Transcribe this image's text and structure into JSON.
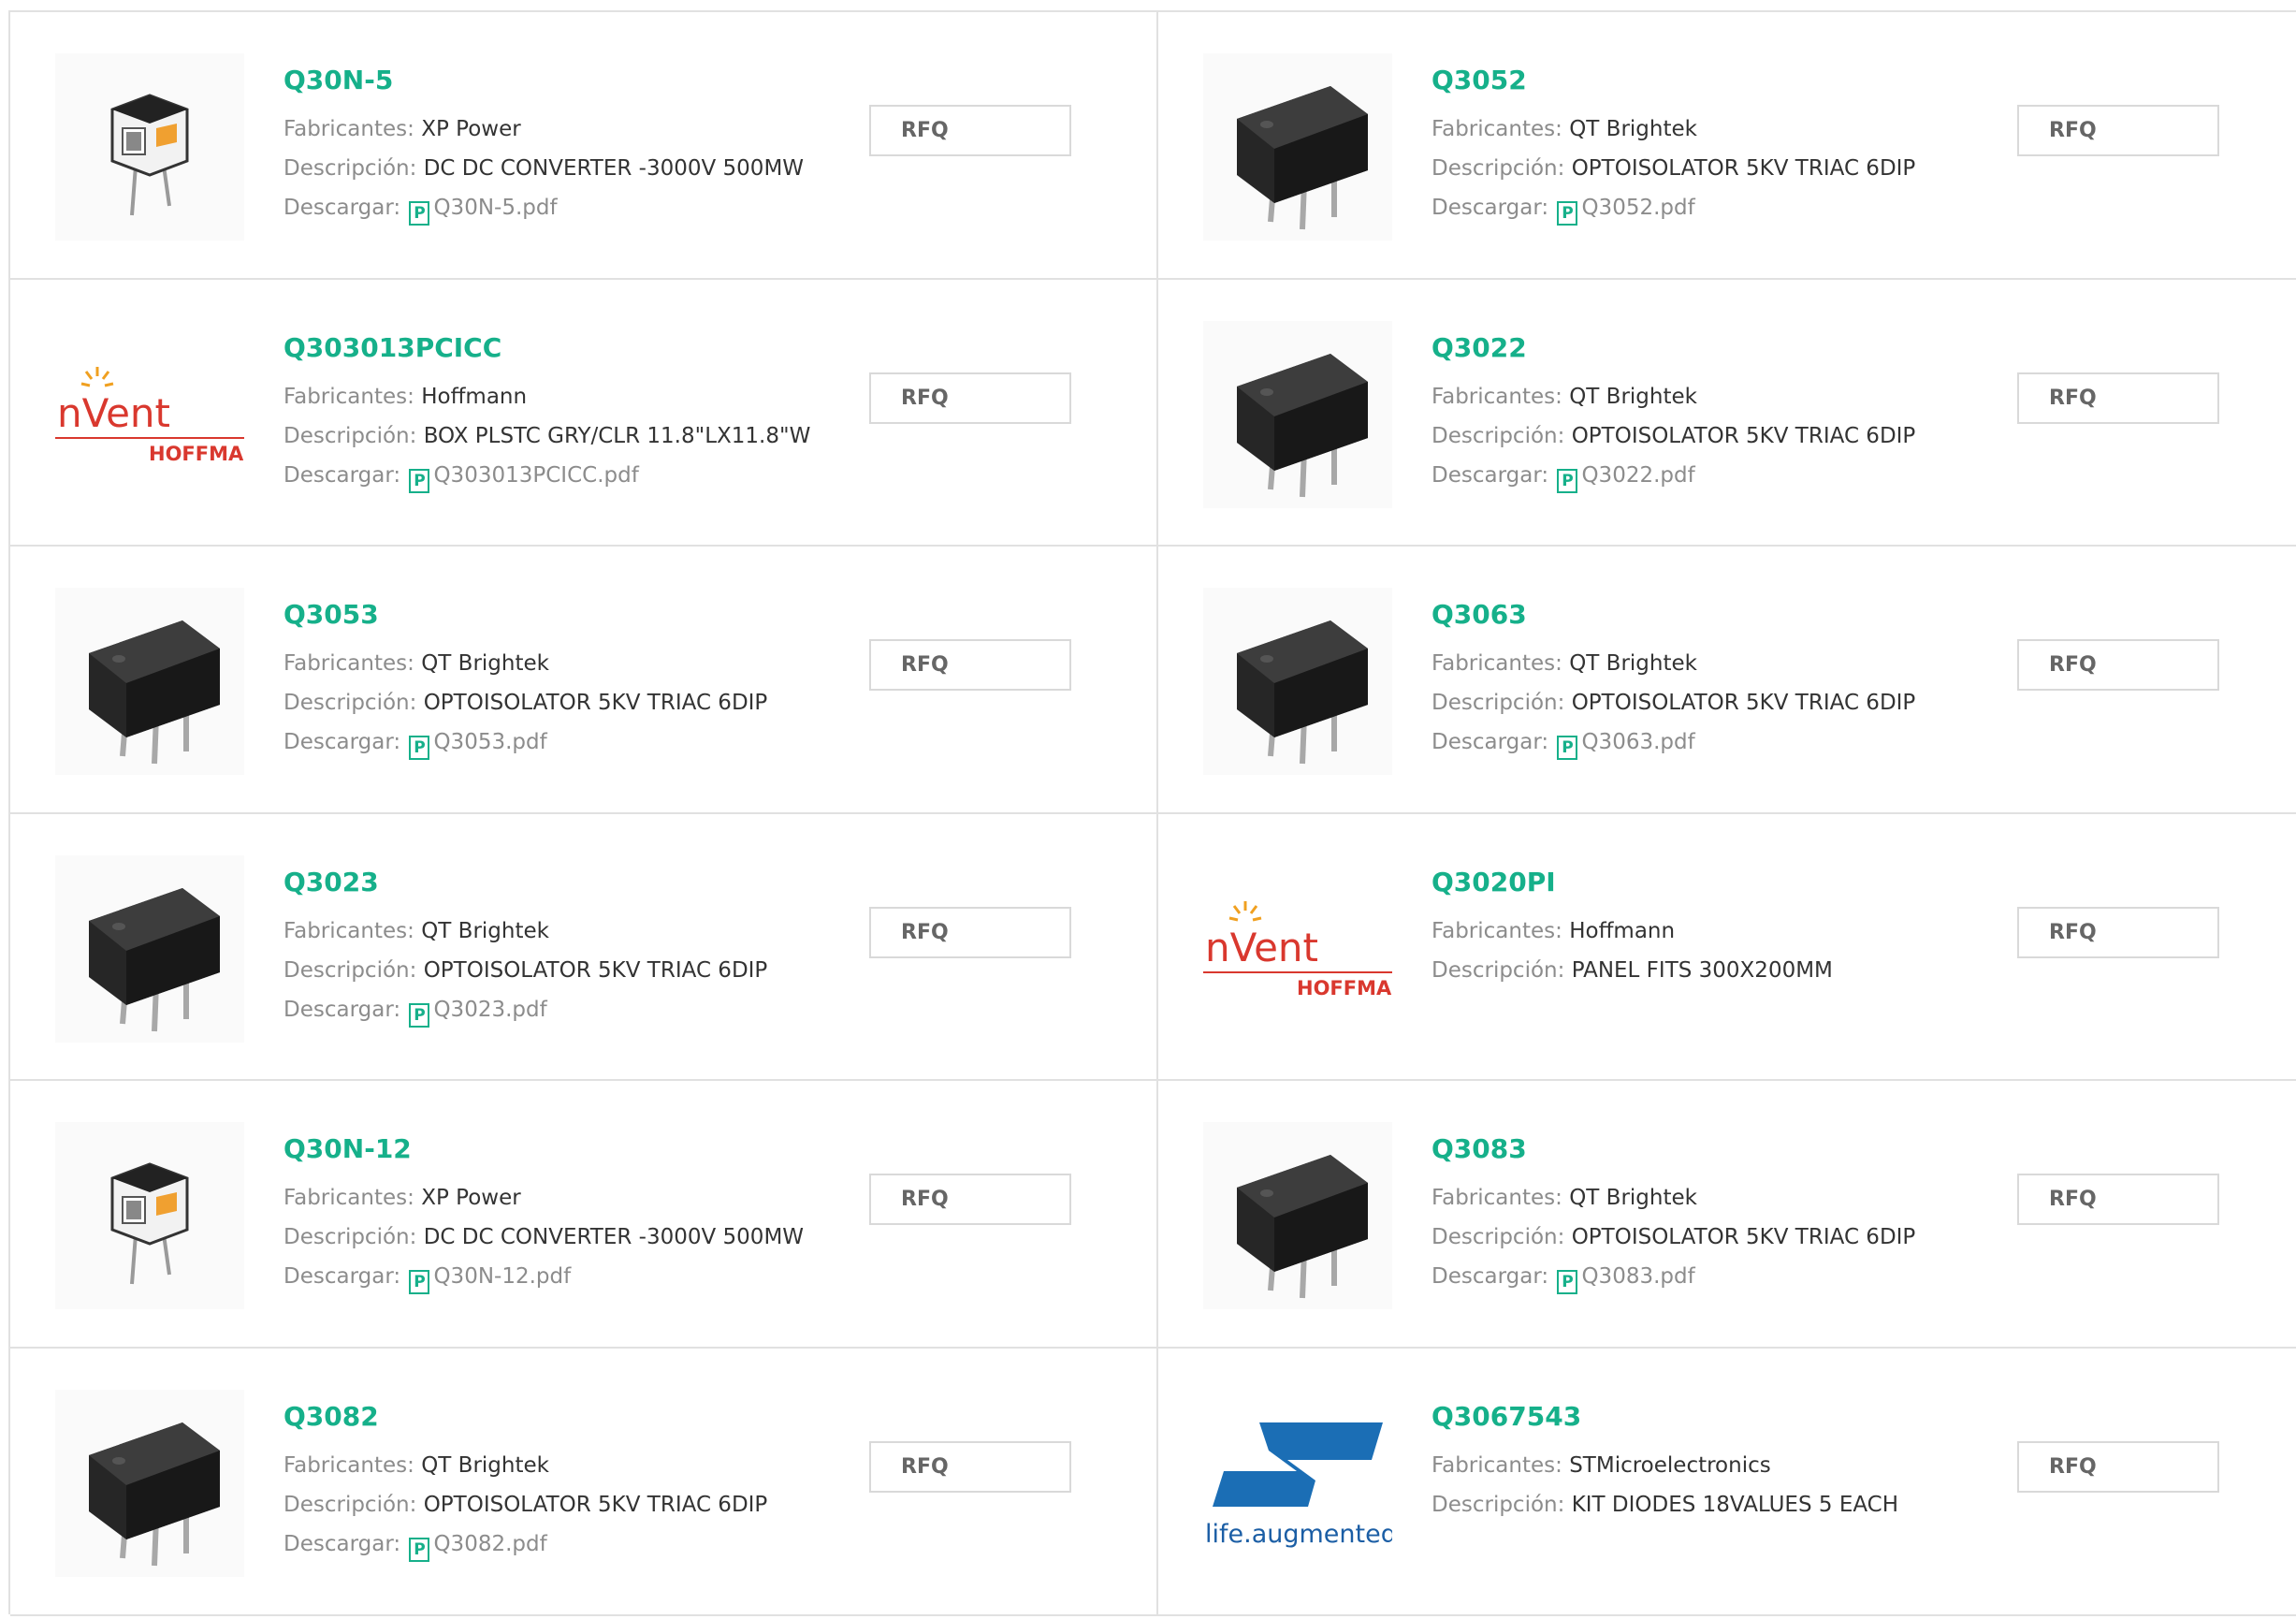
{
  "colors": {
    "accent": "#16b08a",
    "label": "#8c8c8c",
    "text": "#333333",
    "border": "#e1e1e1"
  },
  "products": [
    {
      "part": "Q30N-5",
      "image": "dc-converter-icon",
      "fab_label": "Fabricantes:",
      "manufacturer": "XP Power",
      "desc_label": "Descripción:",
      "description": "DC DC CONVERTER -3000V 500MW",
      "dl_label": "Descargar:",
      "pdf_icon": "P",
      "pdf": "Q30N-5.pdf",
      "rfq": "RFQ"
    },
    {
      "part": "Q3052",
      "image": "optoisolator-dip-icon",
      "fab_label": "Fabricantes:",
      "manufacturer": "QT Brightek",
      "desc_label": "Descripción:",
      "description": "OPTOISOLATOR 5KV TRIAC 6DIP",
      "dl_label": "Descargar:",
      "pdf_icon": "P",
      "pdf": "Q3052.pdf",
      "rfq": "RFQ"
    },
    {
      "part": "Q303013PCICC",
      "image": "nvent-hoffman-logo",
      "logo_text": "nVent",
      "logo_sub": "HOFFMAN",
      "fab_label": "Fabricantes:",
      "manufacturer": "Hoffmann",
      "desc_label": "Descripción:",
      "description": "BOX PLSTC GRY/CLR 11.8\"LX11.8\"W",
      "dl_label": "Descargar:",
      "pdf_icon": "P",
      "pdf": "Q303013PCICC.pdf",
      "rfq": "RFQ"
    },
    {
      "part": "Q3022",
      "image": "optoisolator-dip-icon",
      "fab_label": "Fabricantes:",
      "manufacturer": "QT Brightek",
      "desc_label": "Descripción:",
      "description": "OPTOISOLATOR 5KV TRIAC 6DIP",
      "dl_label": "Descargar:",
      "pdf_icon": "P",
      "pdf": "Q3022.pdf",
      "rfq": "RFQ"
    },
    {
      "part": "Q3053",
      "image": "optoisolator-dip-icon",
      "fab_label": "Fabricantes:",
      "manufacturer": "QT Brightek",
      "desc_label": "Descripción:",
      "description": "OPTOISOLATOR 5KV TRIAC 6DIP",
      "dl_label": "Descargar:",
      "pdf_icon": "P",
      "pdf": "Q3053.pdf",
      "rfq": "RFQ"
    },
    {
      "part": "Q3063",
      "image": "optoisolator-dip-icon",
      "fab_label": "Fabricantes:",
      "manufacturer": "QT Brightek",
      "desc_label": "Descripción:",
      "description": "OPTOISOLATOR 5KV TRIAC 6DIP",
      "dl_label": "Descargar:",
      "pdf_icon": "P",
      "pdf": "Q3063.pdf",
      "rfq": "RFQ"
    },
    {
      "part": "Q3023",
      "image": "optoisolator-dip-icon",
      "fab_label": "Fabricantes:",
      "manufacturer": "QT Brightek",
      "desc_label": "Descripción:",
      "description": "OPTOISOLATOR 5KV TRIAC 6DIP",
      "dl_label": "Descargar:",
      "pdf_icon": "P",
      "pdf": "Q3023.pdf",
      "rfq": "RFQ"
    },
    {
      "part": "Q3020PI",
      "image": "nvent-hoffman-logo",
      "logo_text": "nVent",
      "logo_sub": "HOFFMAN",
      "fab_label": "Fabricantes:",
      "manufacturer": "Hoffmann",
      "desc_label": "Descripción:",
      "description": "PANEL FITS 300X200MM",
      "rfq": "RFQ"
    },
    {
      "part": "Q30N-12",
      "image": "dc-converter-icon",
      "fab_label": "Fabricantes:",
      "manufacturer": "XP Power",
      "desc_label": "Descripción:",
      "description": "DC DC CONVERTER -3000V 500MW",
      "dl_label": "Descargar:",
      "pdf_icon": "P",
      "pdf": "Q30N-12.pdf",
      "rfq": "RFQ"
    },
    {
      "part": "Q3083",
      "image": "optoisolator-dip-icon",
      "fab_label": "Fabricantes:",
      "manufacturer": "QT Brightek",
      "desc_label": "Descripción:",
      "description": "OPTOISOLATOR 5KV TRIAC 6DIP",
      "dl_label": "Descargar:",
      "pdf_icon": "P",
      "pdf": "Q3083.pdf",
      "rfq": "RFQ"
    },
    {
      "part": "Q3082",
      "image": "optoisolator-dip-icon",
      "fab_label": "Fabricantes:",
      "manufacturer": "QT Brightek",
      "desc_label": "Descripción:",
      "description": "OPTOISOLATOR 5KV TRIAC 6DIP",
      "dl_label": "Descargar:",
      "pdf_icon": "P",
      "pdf": "Q3082.pdf",
      "rfq": "RFQ"
    },
    {
      "part": "Q3067543",
      "image": "st-logo",
      "logo_text": "ST",
      "logo_sub": "life.augmented",
      "fab_label": "Fabricantes:",
      "manufacturer": "STMicroelectronics",
      "desc_label": "Descripción:",
      "description": "KIT DIODES 18VALUES 5 EACH",
      "rfq": "RFQ"
    }
  ]
}
